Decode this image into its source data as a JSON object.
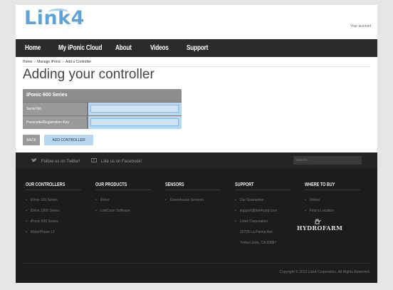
{
  "header": {
    "logo": "Link4",
    "your_account": "Your account"
  },
  "nav": {
    "items": [
      "Home",
      "My iPonic Cloud",
      "About",
      "Videos",
      "Support"
    ]
  },
  "breadcrumb": {
    "items": [
      "Home",
      "Manage iPonic",
      "Add a Controller"
    ]
  },
  "page_title": "Adding your controller",
  "form": {
    "heading": "iPonic 600 Series",
    "serial_label": "Serial No.",
    "serial_value": "",
    "passcode_label": "Passcode/Registration Key",
    "passcode_value": "",
    "back_label": "BACK",
    "add_label": "ADD CONTROLLER"
  },
  "footer": {
    "social": {
      "twitter": "Follow us on Twitter!",
      "facebook": "Like us on Facebook!",
      "search_placeholder": "Search..."
    },
    "columns": {
      "controllers": {
        "title": "OUR CONTROLLERS",
        "items": [
          "iDrive 100 Series",
          "iDrive 1000 Series",
          "iPonic 600 Series",
          "WaterPhase LT"
        ]
      },
      "products": {
        "title": "OUR PRODUCTS",
        "items": [
          "iDrive",
          "LinkConn Software"
        ]
      },
      "sensors": {
        "title": "SENSORS",
        "items": [
          "Greenhouse Sensors"
        ]
      },
      "support": {
        "title": "SUPPORT",
        "items": [
          "Our Guarantee",
          "support@link4corp.com",
          "Link4 Corporation"
        ],
        "address": [
          "22725 La Palma Ave",
          "Yorba Linda, CA 92887"
        ]
      },
      "buy": {
        "title": "WHERE TO BUY",
        "items": [
          "Online",
          "Find a Location"
        ],
        "brand": "HYDROFARM"
      }
    },
    "copyright": "Copyright © 2013 Link4 Corporation. All Rights Reserved."
  },
  "colors": {
    "accent": "#5fa3d8",
    "nav_bg": "#2b2b2b",
    "footer_bg": "#1c1c1c",
    "field_bg": "#b7d7f0"
  }
}
